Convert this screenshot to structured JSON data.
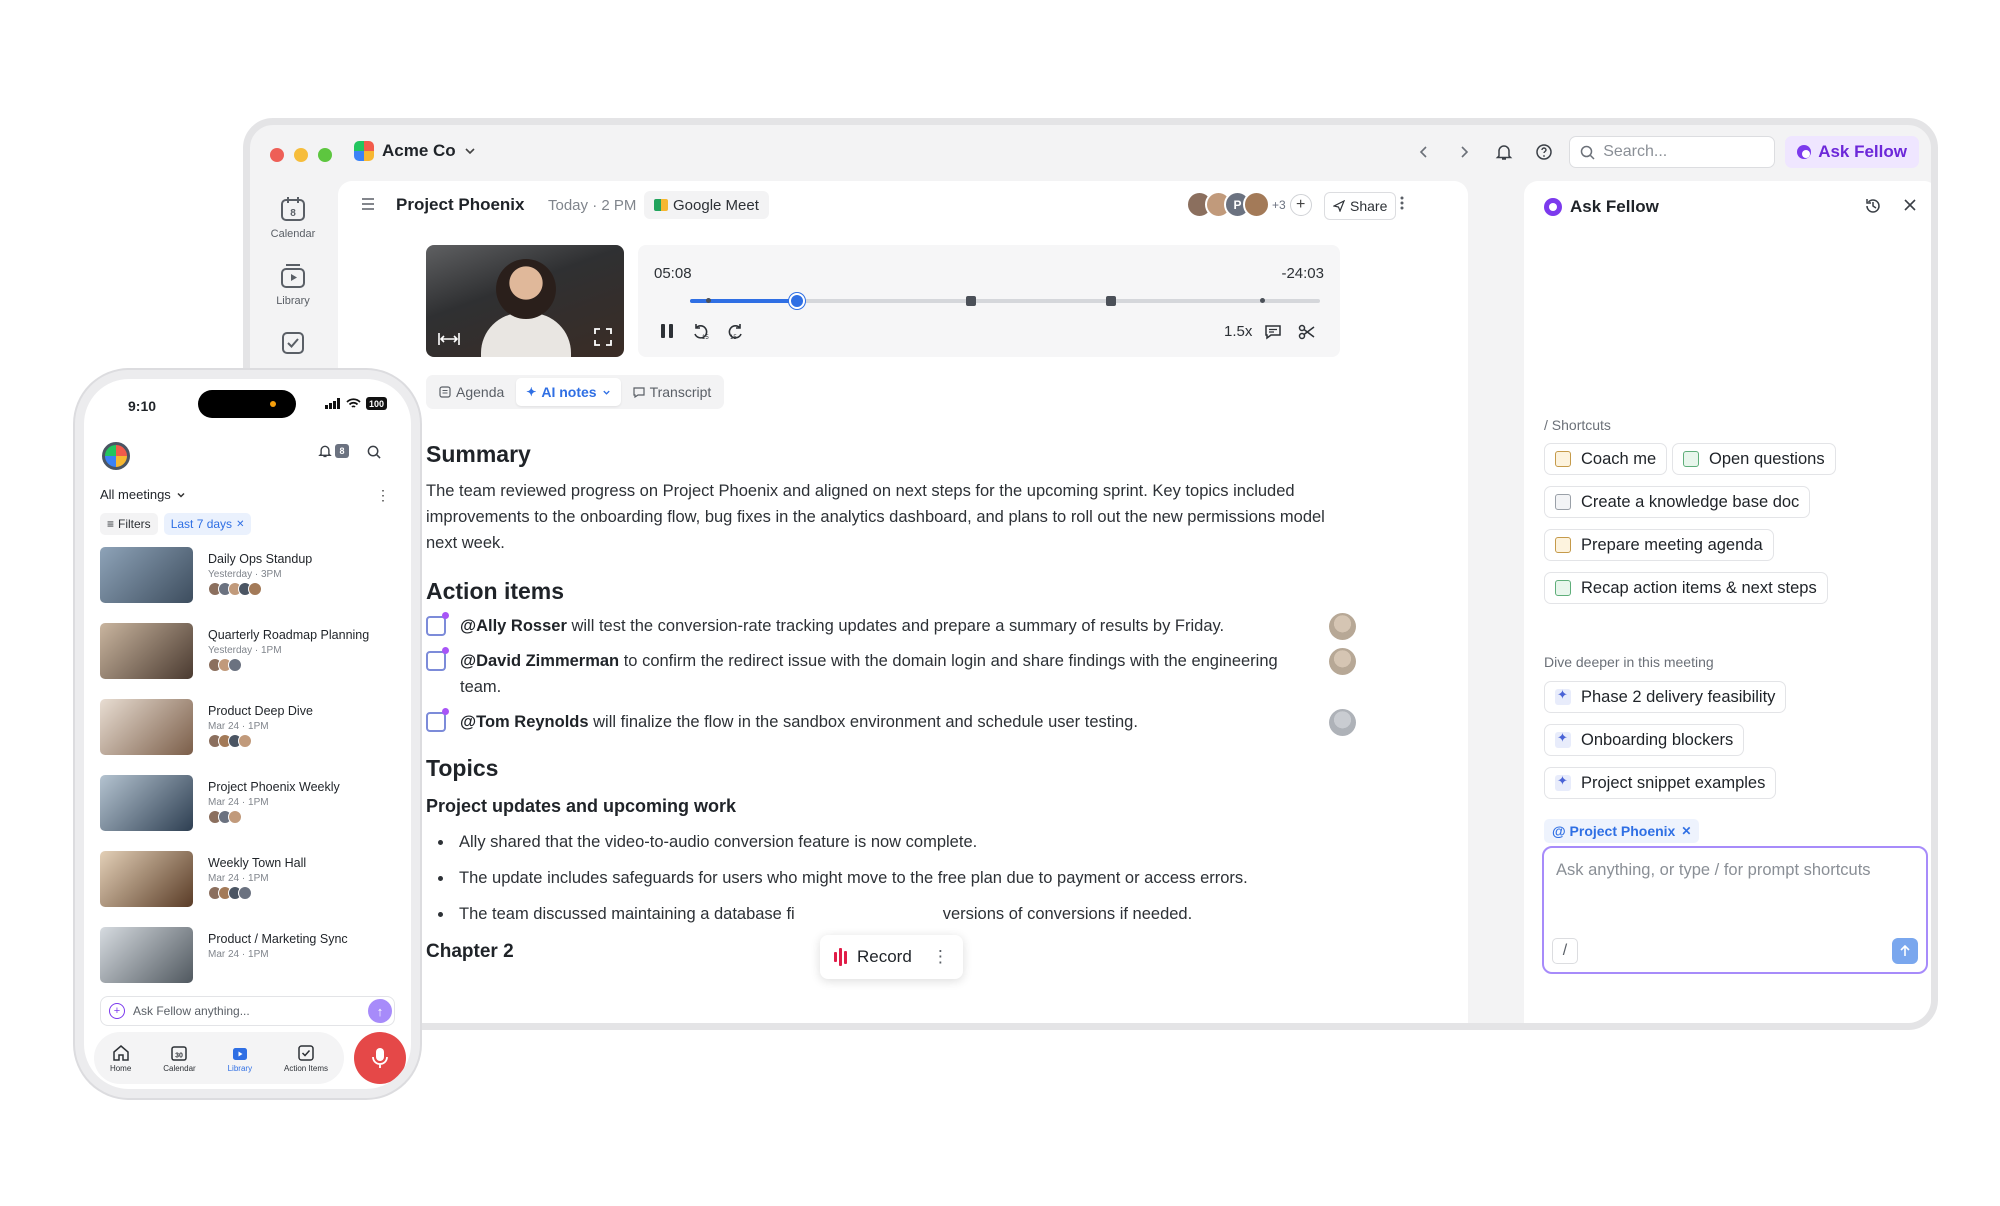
{
  "app": {
    "workspace": "Acme Co",
    "search_placeholder": "Search...",
    "ask_button": "Ask Fellow",
    "colors": {
      "accent": "#2f6fe4",
      "fellow_purple": "#7c3aed",
      "record_red": "#e11d48"
    }
  },
  "sidenav": [
    {
      "label": "Calendar",
      "icon": "calendar-icon",
      "badge": "8"
    },
    {
      "label": "Library",
      "icon": "library-icon"
    }
  ],
  "meeting": {
    "title": "Project Phoenix",
    "time": "Today · 2 PM",
    "platform": "Google Meet",
    "participant_initial": "P",
    "participant_more": "+3",
    "share": "Share"
  },
  "player": {
    "elapsed": "05:08",
    "remaining": "-24:03",
    "progress": 0.17,
    "speed": "1.5x",
    "skip_back": "15",
    "skip_fwd": "15"
  },
  "tabs": [
    {
      "label": "Agenda",
      "active": false
    },
    {
      "label": "AI notes",
      "active": true
    },
    {
      "label": "Transcript",
      "active": false
    }
  ],
  "notes": {
    "summary_heading": "Summary",
    "summary_text": "The team reviewed progress on Project Phoenix and aligned on next steps for the upcoming sprint. Key topics included improvements to the onboarding flow, bug fixes in the analytics dashboard, and plans to roll out the new permissions model next week.",
    "action_heading": "Action items",
    "action_items": [
      {
        "mention": "@Ally Rosser",
        "text": " will test the conversion-rate tracking updates and prepare a summary of results by Friday."
      },
      {
        "mention": "@David Zimmerman",
        "text": " to confirm the redirect issue with the domain login and share findings with the engineering team."
      },
      {
        "mention": "@Tom Reynolds",
        "text": " will finalize the flow in the sandbox environment and schedule user testing."
      }
    ],
    "topics_heading": "Topics",
    "topic_subheading": "Project updates and upcoming work",
    "topic_bullets": [
      "Ally shared that the video-to-audio conversion feature is now complete.",
      "The update includes safeguards for users who might move to the free plan due to payment or access errors.",
      "The team discussed maintaining a database fi",
      "versions of conversions if needed."
    ],
    "chapter_heading": "Chapter 2"
  },
  "record": {
    "label": "Record"
  },
  "ask_panel": {
    "title": "Ask Fellow",
    "shortcuts_label": "/ Shortcuts",
    "shortcuts": [
      "Coach me",
      "Open questions",
      "Create a knowledge base doc",
      "Prepare meeting agenda",
      "Recap action items & next steps"
    ],
    "dive_label": "Dive deeper in this meeting",
    "dive": [
      "Phase 2 delivery feasibility",
      "Onboarding blockers",
      "Project snippet examples"
    ],
    "context_tag": "@ Project Phoenix",
    "input_placeholder": "Ask anything, or type / for prompt shortcuts",
    "slash": "/"
  },
  "phone": {
    "clock": "9:10",
    "battery": "100",
    "notif_count": "8",
    "filter_label": "All meetings",
    "filters_chip": "Filters",
    "range_chip": "Last 7 days",
    "meetings": [
      {
        "title": "Daily Ops Standup",
        "when": "Yesterday · 3PM"
      },
      {
        "title": "Quarterly Roadmap Planning",
        "when": "Yesterday · 1PM"
      },
      {
        "title": "Product Deep Dive",
        "when": "Mar 24 · 1PM"
      },
      {
        "title": "Project Phoenix Weekly",
        "when": "Mar 24 · 1PM"
      },
      {
        "title": "Weekly Town Hall",
        "when": "Mar 24 · 1PM"
      },
      {
        "title": "Product / Marketing Sync",
        "when": "Mar 24 · 1PM"
      }
    ],
    "ask_placeholder": "Ask Fellow anything...",
    "tabbar": [
      {
        "label": "Home",
        "active": false
      },
      {
        "label": "Calendar",
        "active": false
      },
      {
        "label": "Library",
        "active": true
      },
      {
        "label": "Action Items",
        "active": false
      }
    ],
    "calendar_day": "30"
  }
}
